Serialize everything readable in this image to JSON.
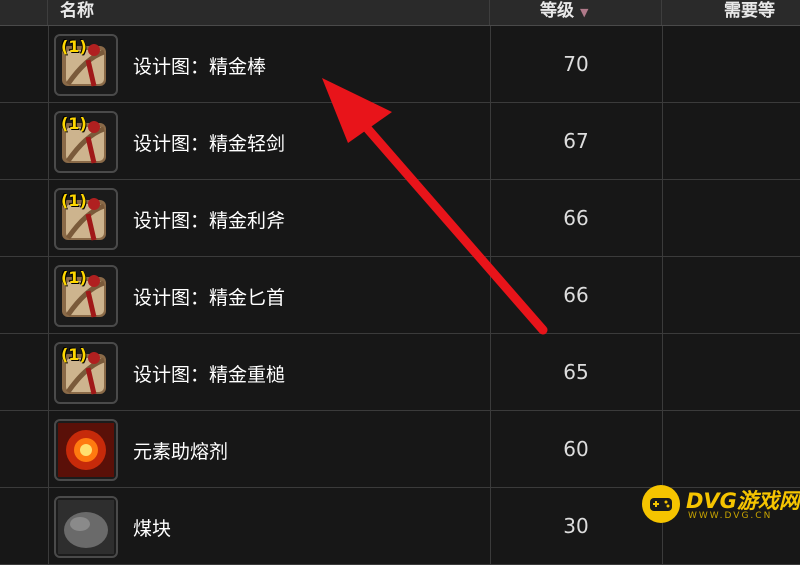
{
  "table": {
    "headers": {
      "name": "名称",
      "level": "等级",
      "sort_indicator": "▼",
      "required": "需要等"
    },
    "rows": [
      {
        "name": "设计图：精金棒",
        "level": "70",
        "count": "(1)",
        "icon": "blueprint-scroll-icon"
      },
      {
        "name": "设计图：精金轻剑",
        "level": "67",
        "count": "(1)",
        "icon": "blueprint-scroll-icon"
      },
      {
        "name": "设计图：精金利斧",
        "level": "66",
        "count": "(1)",
        "icon": "blueprint-scroll-icon"
      },
      {
        "name": "设计图：精金匕首",
        "level": "66",
        "count": "(1)",
        "icon": "blueprint-scroll-icon"
      },
      {
        "name": "设计图：精金重槌",
        "level": "65",
        "count": "(1)",
        "icon": "blueprint-scroll-icon"
      },
      {
        "name": "元素助熔剂",
        "level": "60",
        "count": "",
        "icon": "elemental-flux-icon"
      },
      {
        "name": "煤块",
        "level": "30",
        "count": "",
        "icon": "coal-icon"
      }
    ]
  },
  "watermark": {
    "brand": "DVG游戏网",
    "url": "WWW.DVG.CN"
  },
  "colors": {
    "arrow": "#e8141a",
    "count_badge": "#ffd700",
    "watermark": "#f5c400"
  }
}
